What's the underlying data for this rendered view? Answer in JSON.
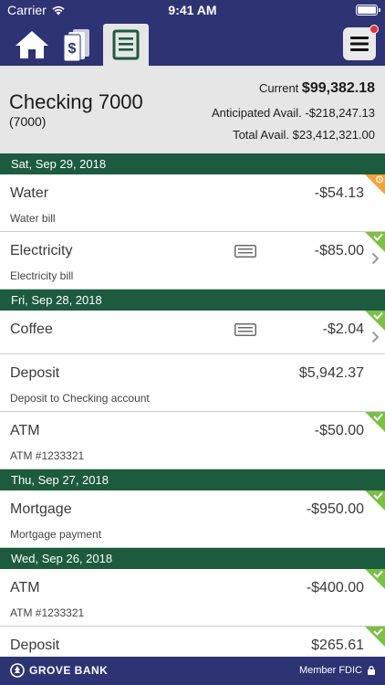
{
  "status_bar": {
    "carrier": "Carrier",
    "time": "9:41 AM"
  },
  "colors": {
    "header_bg": "#2e3373",
    "date_bar": "#1d5b3e",
    "cleared": "#7ac143",
    "pending": "#f2a33a"
  },
  "nav": {
    "icons": [
      "home-icon",
      "money-icon",
      "ledger-icon",
      "menu-icon"
    ]
  },
  "account": {
    "name": "Checking 7000",
    "number": "(7000)",
    "current_label": "Current",
    "current_value": "$99,382.18",
    "anticipated_label": "Anticipated Avail.",
    "anticipated_value": "-$218,247.13",
    "total_label": "Total Avail.",
    "total_value": "$23,412,321.00"
  },
  "groups": [
    {
      "date": "Sat, Sep 29, 2018",
      "transactions": [
        {
          "name": "Water",
          "desc": "Water bill",
          "amount": "-$54.13",
          "status": "pending",
          "receipt": false,
          "chevron": false
        },
        {
          "name": "Electricity",
          "desc": "Electricity bill",
          "amount": "-$85.00",
          "status": "cleared",
          "receipt": true,
          "chevron": true
        }
      ]
    },
    {
      "date": "Fri, Sep 28, 2018",
      "transactions": [
        {
          "name": "Coffee",
          "desc": "",
          "amount": "-$2.04",
          "status": "cleared",
          "receipt": true,
          "chevron": true
        },
        {
          "name": "Deposit",
          "desc": "Deposit to Checking account",
          "amount": "$5,942.37",
          "status": "none",
          "receipt": false,
          "chevron": false
        },
        {
          "name": "ATM",
          "desc": "ATM #1233321",
          "amount": "-$50.00",
          "status": "cleared",
          "receipt": false,
          "chevron": false
        }
      ]
    },
    {
      "date": "Thu, Sep 27, 2018",
      "transactions": [
        {
          "name": "Mortgage",
          "desc": "Mortgage payment",
          "amount": "-$950.00",
          "status": "cleared",
          "receipt": false,
          "chevron": false
        }
      ]
    },
    {
      "date": "Wed, Sep 26, 2018",
      "transactions": [
        {
          "name": "ATM",
          "desc": "ATM #1233321",
          "amount": "-$400.00",
          "status": "cleared",
          "receipt": false,
          "chevron": false
        },
        {
          "name": "Deposit",
          "desc": "",
          "amount": "$265.61",
          "status": "cleared",
          "receipt": false,
          "chevron": false
        }
      ]
    }
  ],
  "footer": {
    "brand": "GROVE BANK",
    "fdic": "Member FDIC"
  }
}
